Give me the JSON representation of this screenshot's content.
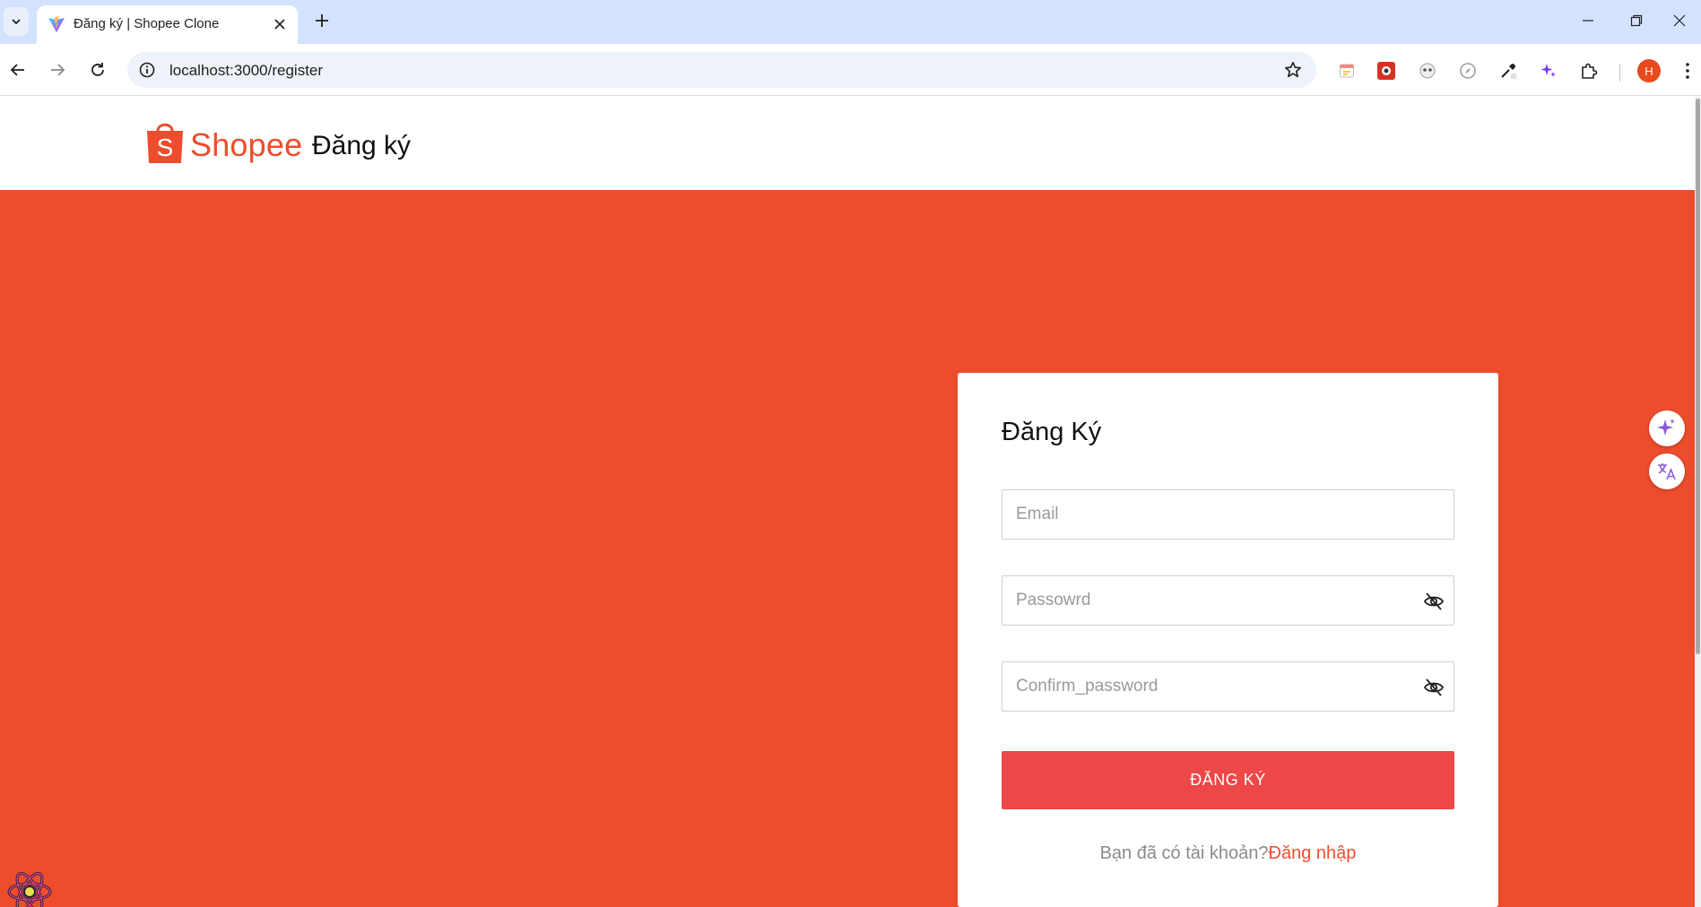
{
  "browser": {
    "tab": {
      "title": "Đăng ký | Shopee Clone",
      "favicon": "vite-icon"
    },
    "address_bar": {
      "url": "localhost:3000/register"
    },
    "profile_initial": "H"
  },
  "site_header": {
    "logo_text": "Shopee",
    "title": "Đăng ký"
  },
  "register_form": {
    "title": "Đăng Ký",
    "email": {
      "value": "",
      "placeholder": "Email"
    },
    "password": {
      "value": "",
      "placeholder": "Passowrd"
    },
    "confirm_password": {
      "value": "",
      "placeholder": "Confirm_password"
    },
    "submit_label": "ĐĂNG KÝ",
    "login_prompt": "Bạn đã có tài khoản?",
    "login_link": "Đăng nhập"
  },
  "colors": {
    "brand": "#ee4d2d",
    "button": "#ee4747",
    "tab_strip": "#d3e3fd"
  },
  "icons": [
    "tab-search-icon",
    "vite-icon",
    "close-icon",
    "plus-icon",
    "back-icon",
    "forward-icon",
    "reload-icon",
    "info-icon",
    "star-icon",
    "extension-icon",
    "puzzle-icon",
    "menu-icon",
    "eye-off-icon",
    "sparkle-icon",
    "translate-icon",
    "react-icon",
    "shopee-bag-icon"
  ]
}
